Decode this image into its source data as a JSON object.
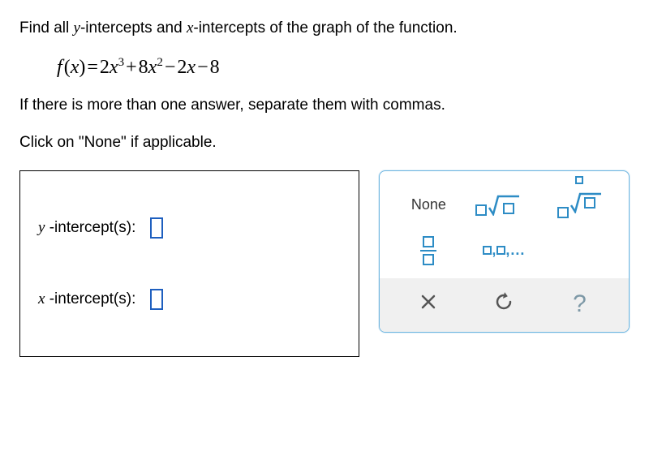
{
  "prompt": {
    "line1_pre": "Find all ",
    "y_label": "y",
    "intercepts_mid": "-intercepts and ",
    "x_label": "x",
    "line1_post": "-intercepts of the graph of the function.",
    "line2": "If there is more than one answer, separate them with commas.",
    "line3": "Click on \"None\" if applicable."
  },
  "equation": {
    "f": "f",
    "open": "(",
    "var": "x",
    "close": ")",
    "eq": "=",
    "c3": "2",
    "v3": "x",
    "e3": "3",
    "p1": "+",
    "c2": "8",
    "v2": "x",
    "e2": "2",
    "m1": "−",
    "c1": "2",
    "v1": "x",
    "m2": "−",
    "c0": "8"
  },
  "answers": {
    "y_label_var": "y",
    "y_label_text": " -intercept(s):",
    "x_label_var": "x",
    "x_label_text": " -intercept(s):"
  },
  "palette": {
    "none": "None",
    "sequence": ",...",
    "help": "?"
  }
}
